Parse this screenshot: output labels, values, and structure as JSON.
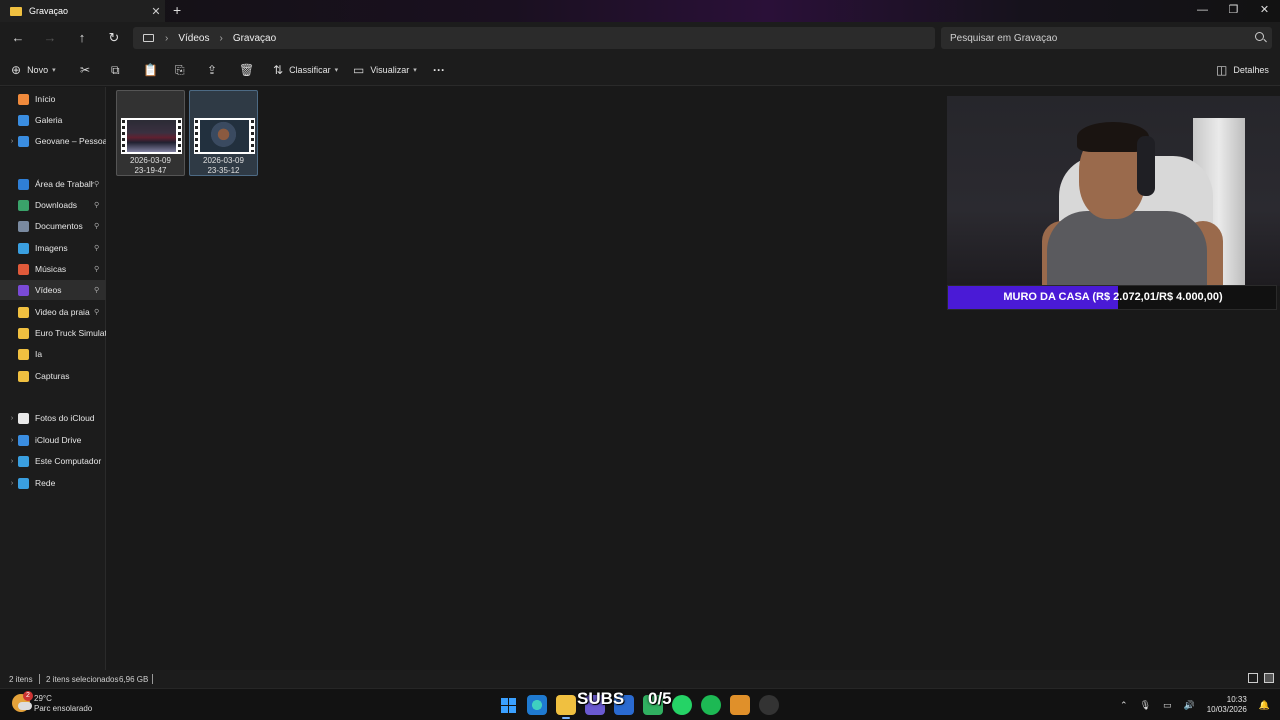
{
  "window": {
    "tab_title": "Gravaçao",
    "new_tab": "+",
    "close_tab": "✕",
    "minimize": "—",
    "maximize": "❐",
    "close": "✕"
  },
  "nav": {
    "back": "←",
    "forward": "→",
    "up": "↑",
    "refresh": "↻",
    "breadcrumb": [
      "Vídeos",
      "Gravaçao"
    ],
    "chevron": "›",
    "search_placeholder": "Pesquisar em Gravaçao"
  },
  "toolbar": {
    "new_label": "Novo",
    "sort_label": "Classificar",
    "view_label": "Visualizar",
    "more_label": "···",
    "details_label": "Detalhes"
  },
  "sidebar": {
    "items": [
      {
        "label": "Início",
        "icon": "home-icon",
        "color": "#f08a3c",
        "expand": false
      },
      {
        "label": "Galeria",
        "icon": "gallery-icon",
        "color": "#3a8de0",
        "expand": false
      },
      {
        "label": "Geovane – Pessoal",
        "icon": "onedrive-icon",
        "color": "#3a8de0",
        "expand": true
      },
      {
        "label": "Área de Trabalho",
        "icon": "desktop-icon",
        "color": "#2f7fd6",
        "pin": true
      },
      {
        "label": "Downloads",
        "icon": "download-icon",
        "color": "#3aa36a",
        "pin": true
      },
      {
        "label": "Documentos",
        "icon": "document-icon",
        "color": "#7a8aa0",
        "pin": true
      },
      {
        "label": "Imagens",
        "icon": "pictures-icon",
        "color": "#3a9fe0",
        "pin": true
      },
      {
        "label": "Músicas",
        "icon": "music-icon",
        "color": "#e05a3a",
        "pin": true
      },
      {
        "label": "Vídeos",
        "icon": "videos-icon",
        "color": "#7a4ad6",
        "pin": true,
        "selected": true
      },
      {
        "label": "Video da praia",
        "icon": "folder-icon",
        "color": "#f0c040",
        "pin": true
      },
      {
        "label": "Euro Truck Simulator",
        "icon": "folder-icon",
        "color": "#f0c040"
      },
      {
        "label": "Ia",
        "icon": "folder-icon",
        "color": "#f0c040"
      },
      {
        "label": "Capturas",
        "icon": "folder-icon",
        "color": "#f0c040"
      },
      {
        "label": "Fotos do iCloud",
        "icon": "icloud-photos-icon",
        "color": "#e8e8e8",
        "expand": true
      },
      {
        "label": "iCloud Drive",
        "icon": "icloud-icon",
        "color": "#3a8de0",
        "expand": true
      },
      {
        "label": "Este Computador",
        "icon": "computer-icon",
        "color": "#3a9fe0",
        "expand": true
      },
      {
        "label": "Rede",
        "icon": "network-icon",
        "color": "#3a9fe0",
        "expand": true
      }
    ],
    "pin_glyph": "📌"
  },
  "files": [
    {
      "line1": "2026-03-09",
      "line2": "23-19-47"
    },
    {
      "line1": "2026-03-09",
      "line2": "23-35-12"
    }
  ],
  "overlay": {
    "goal_text": "MURO DA CASA (R$ 2.072,01/R$ 4.000,00)",
    "goal_fraction": 0.518,
    "goal_color": "#4a1ad6",
    "subs_label": "SUBS",
    "subs_count": "0/5"
  },
  "status": {
    "count": "2 itens",
    "selected": "2 itens selecionados",
    "size": "6,96 GB"
  },
  "taskbar": {
    "temperature": "29°C",
    "weather": "Parc ensolarado",
    "weather_badge": "2",
    "time": "10:33",
    "date": "10/03/2026"
  }
}
